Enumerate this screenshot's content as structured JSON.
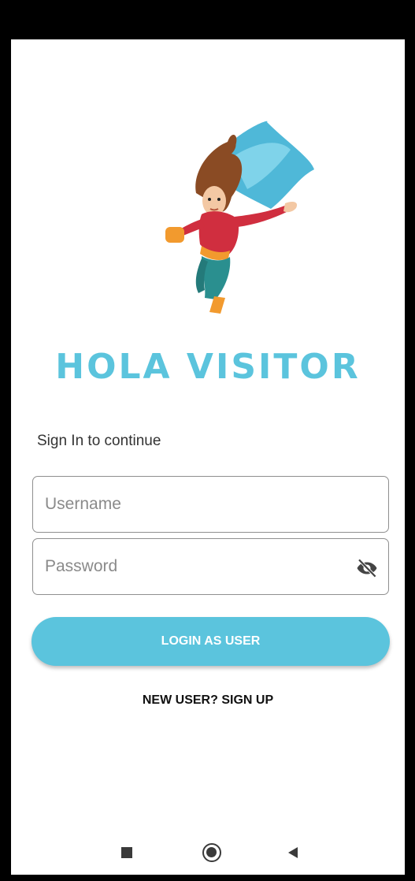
{
  "app": {
    "title": "HOLA VISITOR",
    "subtitle": "Sign In to continue",
    "accent_color": "#5bc4dd"
  },
  "form": {
    "username_placeholder": "Username",
    "username_value": "",
    "password_placeholder": "Password",
    "password_value": "",
    "password_toggle_icon": "eye-off-icon",
    "login_label": "LOGIN AS USER",
    "signup_label": "NEW USER? SIGN UP"
  },
  "navigation": {
    "recent_icon": "square-icon",
    "home_icon": "circle-icon",
    "back_icon": "triangle-left-icon"
  }
}
